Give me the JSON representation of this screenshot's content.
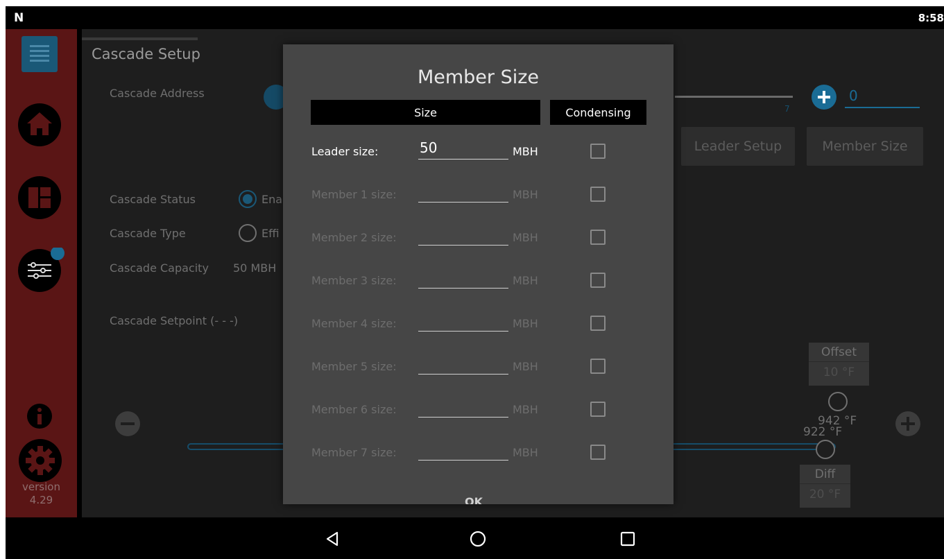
{
  "status_bar": {
    "logo": "N",
    "time": "8:58"
  },
  "sidebar": {
    "version_label": "version",
    "version_number": "4.29"
  },
  "page": {
    "title": "Cascade Setup",
    "cascade_address_label": "Cascade Address",
    "address_value": "0",
    "address_tick": "7",
    "leader_setup_label": "Leader Setup",
    "member_size_label": "Member Size",
    "cascade_status_label": "Cascade Status",
    "cascade_status_option": "Ena",
    "cascade_type_label": "Cascade Type",
    "cascade_type_option": "Effi",
    "cascade_capacity_label": "Cascade Capacity",
    "cascade_capacity_value": "50 MBH",
    "cascade_setpoint_label": "Cascade Setpoint (- - -)",
    "offset_label": "Offset",
    "offset_value": "10 °F",
    "diff_label": "Diff",
    "diff_value": "20 °F",
    "thumb_upper_value": "942 °F",
    "thumb_lower_value": "922 °F"
  },
  "dialog": {
    "title": "Member Size",
    "col_size": "Size",
    "col_condensing": "Condensing",
    "ok_label": "OK",
    "rows": [
      {
        "label": "Leader size:",
        "value": "50",
        "unit": "MBH"
      },
      {
        "label": "Member 1 size:",
        "value": "",
        "unit": "MBH"
      },
      {
        "label": "Member 2 size:",
        "value": "",
        "unit": "MBH"
      },
      {
        "label": "Member 3 size:",
        "value": "",
        "unit": "MBH"
      },
      {
        "label": "Member 4 size:",
        "value": "",
        "unit": "MBH"
      },
      {
        "label": "Member 5 size:",
        "value": "",
        "unit": "MBH"
      },
      {
        "label": "Member 6 size:",
        "value": "",
        "unit": "MBH"
      },
      {
        "label": "Member 7 size:",
        "value": "",
        "unit": "MBH"
      }
    ]
  },
  "colors": {
    "sidebar_bg": "#5a1515",
    "accent_blue": "#1a5877",
    "dialog_bg": "#464646"
  },
  "icons": {
    "menu": "menu-icon",
    "home": "home-icon",
    "dashboard": "dashboard-icon",
    "settings_sliders": "sliders-icon",
    "info": "info-icon",
    "gear": "gear-icon",
    "nav_back": "back-triangle-icon",
    "nav_home": "home-circle-icon",
    "nav_recent": "recent-square-icon"
  }
}
